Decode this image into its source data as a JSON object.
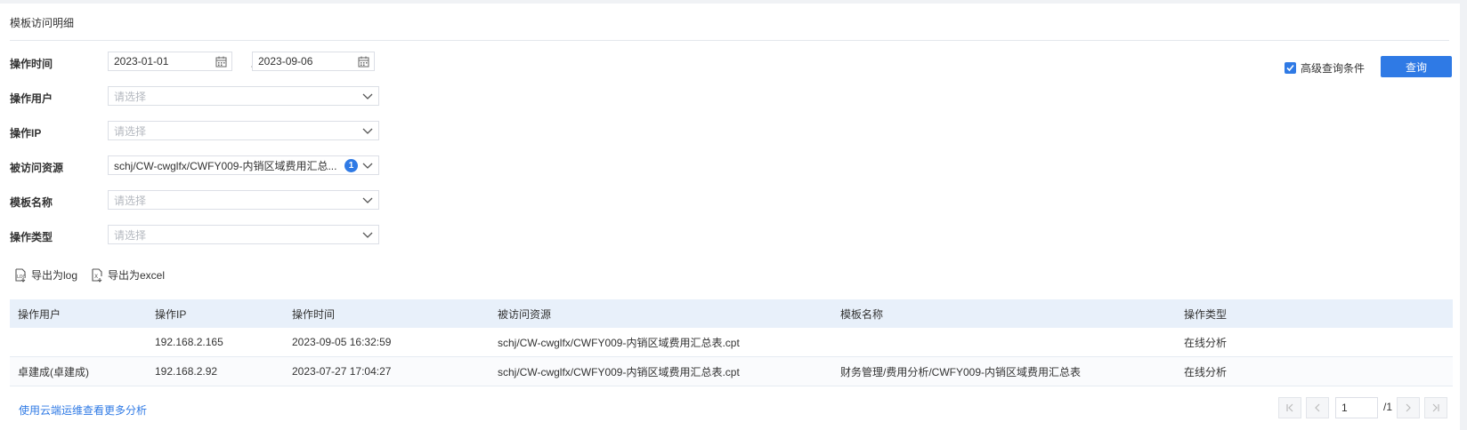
{
  "panel": {
    "title": "模板访问明细"
  },
  "form": {
    "time": {
      "label": "操作时间",
      "start": "2023-01-01",
      "separator": "-",
      "end": "2023-09-06"
    },
    "user": {
      "label": "操作用户",
      "placeholder": "请选择"
    },
    "ip": {
      "label": "操作IP",
      "placeholder": "请选择"
    },
    "resource": {
      "label": "被访问资源",
      "value": "schj/CW-cwglfx/CWFY009-内销区域费用汇总...",
      "badge": "1"
    },
    "template": {
      "label": "模板名称",
      "placeholder": "请选择"
    },
    "optype": {
      "label": "操作类型",
      "placeholder": "请选择"
    },
    "advanced": {
      "label": "高级查询条件",
      "checked": true
    },
    "query_button": "查询"
  },
  "exports": {
    "log": "导出为log",
    "excel": "导出为excel"
  },
  "table": {
    "headers": [
      "操作用户",
      "操作IP",
      "操作时间",
      "被访问资源",
      "模板名称",
      "操作类型"
    ],
    "rows": [
      {
        "user": "",
        "ip": "192.168.2.165",
        "time": "2023-09-05 16:32:59",
        "resource": "schj/CW-cwglfx/CWFY009-内销区域费用汇总表.cpt",
        "template": "",
        "type": "在线分析"
      },
      {
        "user": "卓建成(卓建成)",
        "ip": "192.168.2.92",
        "time": "2023-07-27 17:04:27",
        "resource": "schj/CW-cwglfx/CWFY009-内销区域费用汇总表.cpt",
        "template": "财务管理/费用分析/CWFY009-内销区域费用汇总表",
        "type": "在线分析"
      }
    ]
  },
  "footer": {
    "link": "使用云端运维查看更多分析"
  },
  "pager": {
    "current": "1",
    "total": "/1"
  },
  "colors": {
    "accent": "#2f7ae5",
    "header_bg": "#e8f0fa"
  },
  "icons": [
    "calendar-icon",
    "chevron-down-icon",
    "checkbox-checked-icon",
    "export-log-icon",
    "export-excel-icon",
    "first-page-icon",
    "prev-page-icon",
    "next-page-icon",
    "last-page-icon"
  ]
}
